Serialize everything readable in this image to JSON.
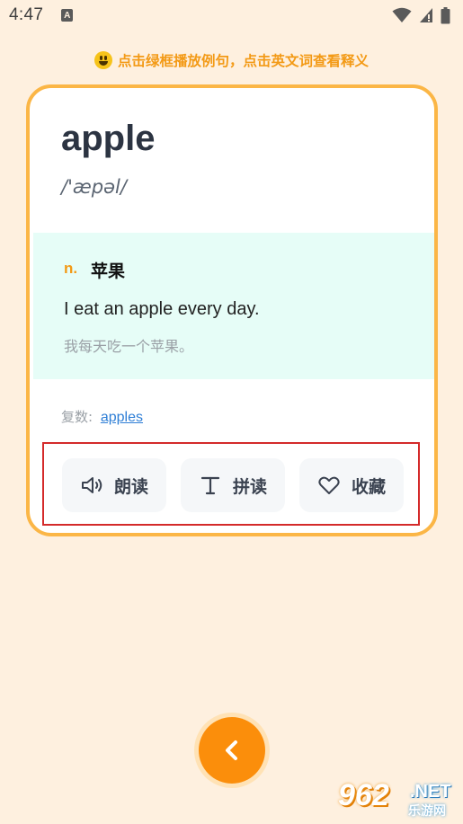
{
  "status_bar": {
    "time": "4:47",
    "notification_glyph": "A"
  },
  "tip": {
    "text": "点击绿框播放例句，点击英文词查看释义",
    "emoji": "grinning-face"
  },
  "card": {
    "word": "apple",
    "phonetic": "/'æpəl/",
    "part_of_speech": "n.",
    "meaning_cn": "苹果",
    "example_en": "I eat an apple every day.",
    "example_cn": "我每天吃一个苹果。",
    "plural_label": "复数:",
    "plural_value": "apples"
  },
  "actions": {
    "read_label": "朗读",
    "spell_label": "拼读",
    "favorite_label": "收藏"
  },
  "watermark": {
    "number": "962",
    "domain": ".NET",
    "cn": "乐游网"
  },
  "colors": {
    "accent": "#fb8e0b",
    "card_border": "#fbb646",
    "meaning_bg": "#e6fdf7",
    "highlight_frame": "#d42a2a",
    "link": "#2f7fd6"
  }
}
